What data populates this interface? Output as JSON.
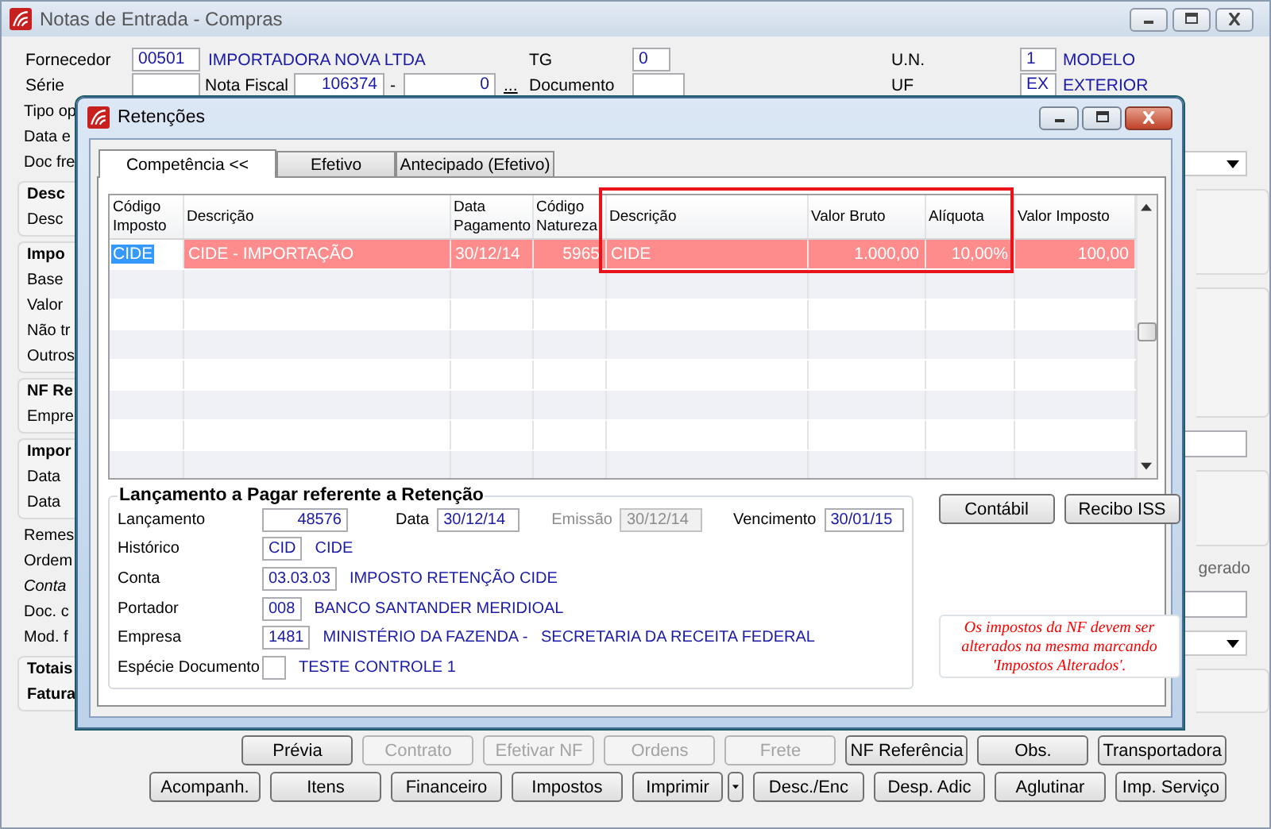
{
  "main_window": {
    "title": "Notas de Entrada - Compras",
    "fornecedor": {
      "label": "Fornecedor",
      "code": "00501",
      "name": "IMPORTADORA NOVA LTDA"
    },
    "tg": {
      "label": "TG",
      "value": "0"
    },
    "un": {
      "label": "U.N.",
      "code": "1",
      "name": "MODELO"
    },
    "serie": {
      "label": "Série"
    },
    "nota_fiscal": {
      "label": "Nota Fiscal",
      "number": "106374",
      "separator": "-",
      "suffix": "0",
      "lookup": "..."
    },
    "documento": {
      "label": "Documento"
    },
    "uf": {
      "label": "UF",
      "code": "EX",
      "name": "EXTERIOR"
    },
    "side_groups": [
      {
        "boxed": false,
        "items": [
          {
            "text": "Tipo op",
            "kind": "plain"
          },
          {
            "text": "Data e",
            "kind": "plain"
          },
          {
            "text": "Doc fre",
            "kind": "plain"
          }
        ]
      },
      {
        "boxed": true,
        "items": [
          {
            "text": "Desc",
            "kind": "bold"
          },
          {
            "text": "Desc",
            "kind": "plain"
          }
        ]
      },
      {
        "boxed": true,
        "items": [
          {
            "text": "Impo",
            "kind": "bold"
          },
          {
            "text": "Base",
            "kind": "plain"
          },
          {
            "text": "Valor",
            "kind": "plain"
          },
          {
            "text": "Não tr",
            "kind": "plain"
          },
          {
            "text": "Outros",
            "kind": "plain"
          }
        ]
      },
      {
        "boxed": true,
        "items": [
          {
            "text": "NF Re",
            "kind": "bold"
          },
          {
            "text": "Empre",
            "kind": "plain"
          }
        ]
      },
      {
        "boxed": true,
        "items": [
          {
            "text": "Impor",
            "kind": "bold"
          },
          {
            "text": "Data",
            "kind": "plain"
          },
          {
            "text": "Data",
            "kind": "plain"
          }
        ]
      },
      {
        "boxed": false,
        "items": [
          {
            "text": "Remes",
            "kind": "plain"
          },
          {
            "text": "Ordem",
            "kind": "plain"
          },
          {
            "text": "Conta",
            "kind": "italic"
          },
          {
            "text": "Doc. c",
            "kind": "plain"
          },
          {
            "text": "Mod. f",
            "kind": "plain"
          }
        ]
      },
      {
        "boxed": true,
        "items": [
          {
            "text": "Totais",
            "kind": "bold"
          },
          {
            "text": "Fatura",
            "kind": "bold"
          }
        ]
      }
    ],
    "right_label": "gerado",
    "toolbar_rows": [
      [
        {
          "label": "Prévia",
          "disabled": false,
          "kind": "button"
        },
        {
          "label": "Contrato",
          "disabled": true,
          "kind": "button"
        },
        {
          "label": "Efetivar NF",
          "disabled": true,
          "kind": "button"
        },
        {
          "label": "Ordens",
          "disabled": true,
          "kind": "button"
        },
        {
          "label": "Frete",
          "disabled": true,
          "kind": "button"
        },
        {
          "label": "NF Referência",
          "disabled": false,
          "kind": "button"
        },
        {
          "label": "Obs.",
          "disabled": false,
          "kind": "button"
        },
        {
          "label": "Transportadora",
          "disabled": false,
          "kind": "button"
        }
      ],
      [
        {
          "label": "Acompanh.",
          "disabled": false,
          "kind": "button"
        },
        {
          "label": "Itens",
          "disabled": false,
          "kind": "button"
        },
        {
          "label": "Financeiro",
          "disabled": false,
          "kind": "button"
        },
        {
          "label": "Impostos",
          "disabled": false,
          "kind": "button"
        },
        {
          "label": "Imprimir",
          "disabled": false,
          "kind": "split"
        },
        {
          "label": "Desc./Enc",
          "disabled": false,
          "kind": "button"
        },
        {
          "label": "Desp. Adic",
          "disabled": false,
          "kind": "button"
        },
        {
          "label": "Aglutinar",
          "disabled": false,
          "kind": "button"
        },
        {
          "label": "Imp. Serviço",
          "disabled": false,
          "kind": "button"
        }
      ]
    ]
  },
  "dialog": {
    "title": "Retenções",
    "tabs": [
      {
        "label": "Competência <<",
        "selected": true
      },
      {
        "label": "Efetivo",
        "selected": false
      },
      {
        "label": "Antecipado (Efetivo)",
        "selected": false
      }
    ],
    "table": {
      "columns": [
        "Código Imposto",
        "Descrição",
        "Data Pagamento",
        "Código Natureza",
        "Descrição",
        "Valor Bruto",
        "Alíquota",
        "Valor Imposto"
      ],
      "rows": [
        {
          "cells": [
            "CIDE",
            "CIDE - IMPORTAÇÃO",
            "30/12/14",
            "5965",
            "CIDE",
            "1.000,00",
            "10,00%",
            "100,00"
          ],
          "selected": true
        }
      ]
    },
    "entry": {
      "title": "Lançamento a Pagar referente a Retenção",
      "lancamento": {
        "label": "Lançamento",
        "value": "48576"
      },
      "data": {
        "label": "Data",
        "value": "30/12/14"
      },
      "emissao": {
        "label": "Emissão",
        "value": "30/12/14",
        "disabled": true
      },
      "vencimento": {
        "label": "Vencimento",
        "value": "30/01/15"
      },
      "lookups": [
        {
          "label": "Histórico",
          "code": "CID",
          "name": "CIDE"
        },
        {
          "label": "Conta",
          "code": "03.03.03",
          "name": "IMPOSTO RETENÇÃO CIDE"
        },
        {
          "label": "Portador",
          "code": "008",
          "name": "BANCO SANTANDER MERIDIOAL"
        },
        {
          "label": "Empresa",
          "code": "1481",
          "name": "MINISTÉRIO DA FAZENDA -   SECRETARIA DA RECEITA FEDERAL"
        },
        {
          "label": "Espécie Documento",
          "name": "TESTE CONTROLE 1"
        }
      ]
    },
    "buttons": [
      "Contábil",
      "Recibo ISS"
    ],
    "note_lines": [
      "Os impostos da NF devem ser",
      "alterados na mesma marcando",
      "'Impostos Alterados'."
    ]
  }
}
